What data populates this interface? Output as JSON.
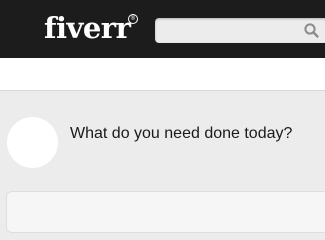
{
  "header": {
    "logo_text": "fiverr",
    "logo_mark": "®",
    "search": {
      "value": "",
      "placeholder": "",
      "icon": "search-icon"
    }
  },
  "main": {
    "prompt_text": "What do you need done today?"
  },
  "colors": {
    "topbar": "#1c1c1c",
    "page_background": "#ececec",
    "subbar": "#ffffff"
  }
}
